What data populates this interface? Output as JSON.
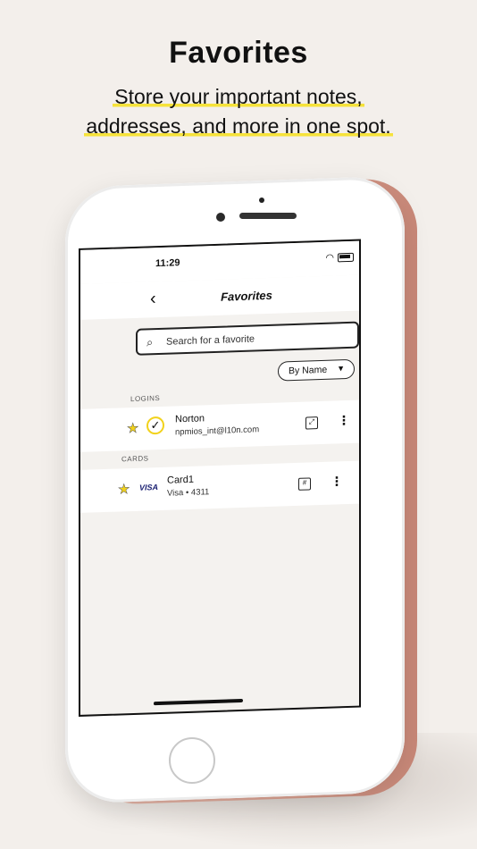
{
  "header": {
    "title": "Favorites",
    "subtitle_line1": "Store your important notes,",
    "subtitle_line2": "addresses, and more in one spot."
  },
  "status_bar": {
    "time": "11:29"
  },
  "nav": {
    "back_icon": "chevron-left-icon",
    "title": "Favorites"
  },
  "search": {
    "placeholder": "Search for a favorite"
  },
  "sort": {
    "label": "By Name"
  },
  "sections": [
    {
      "label": "LOGINS",
      "items": [
        {
          "title": "Norton",
          "subtitle": "npmios_int@l10n.com"
        }
      ]
    },
    {
      "label": "CARDS",
      "items": [
        {
          "title": "Card1",
          "subtitle": "Visa • 4311",
          "brand": "VISA"
        }
      ]
    }
  ],
  "colors": {
    "accent": "#f2d21b",
    "phone": "#d9a090",
    "background": "#f3efeb"
  }
}
